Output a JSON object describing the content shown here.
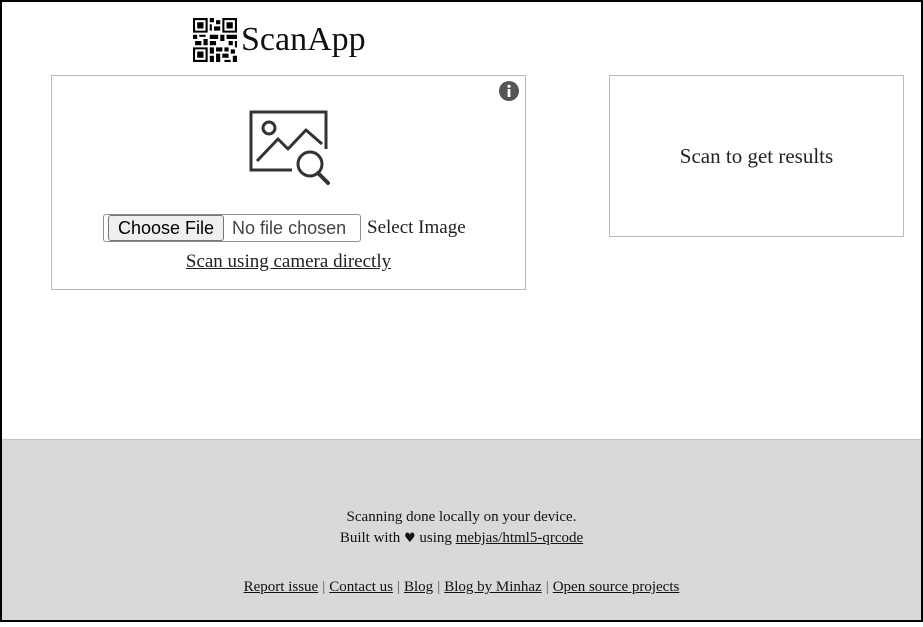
{
  "app": {
    "title": "ScanApp",
    "logo_icon": "qr-code-icon"
  },
  "scanner": {
    "info_icon": "info-icon",
    "image_icon": "image-search-icon",
    "choose_file_label": "Choose File",
    "no_file_text": "No file chosen",
    "select_image_label": "Select Image",
    "camera_link": "Scan using camera directly"
  },
  "results": {
    "placeholder": "Scan to get results"
  },
  "footer": {
    "line1": "Scanning done locally on your device.",
    "built_with_prefix": "Built with",
    "heart": "♥",
    "built_with_using": "using",
    "repo_link": "mebjas/html5-qrcode",
    "links": [
      "Report issue",
      "Contact us",
      "Blog",
      "Blog by Minhaz",
      "Open source projects"
    ],
    "separator": "|"
  },
  "colors": {
    "footer_bg": "#d9d9d9",
    "panel_border": "#b8b8b8",
    "frame_border": "#000000"
  }
}
